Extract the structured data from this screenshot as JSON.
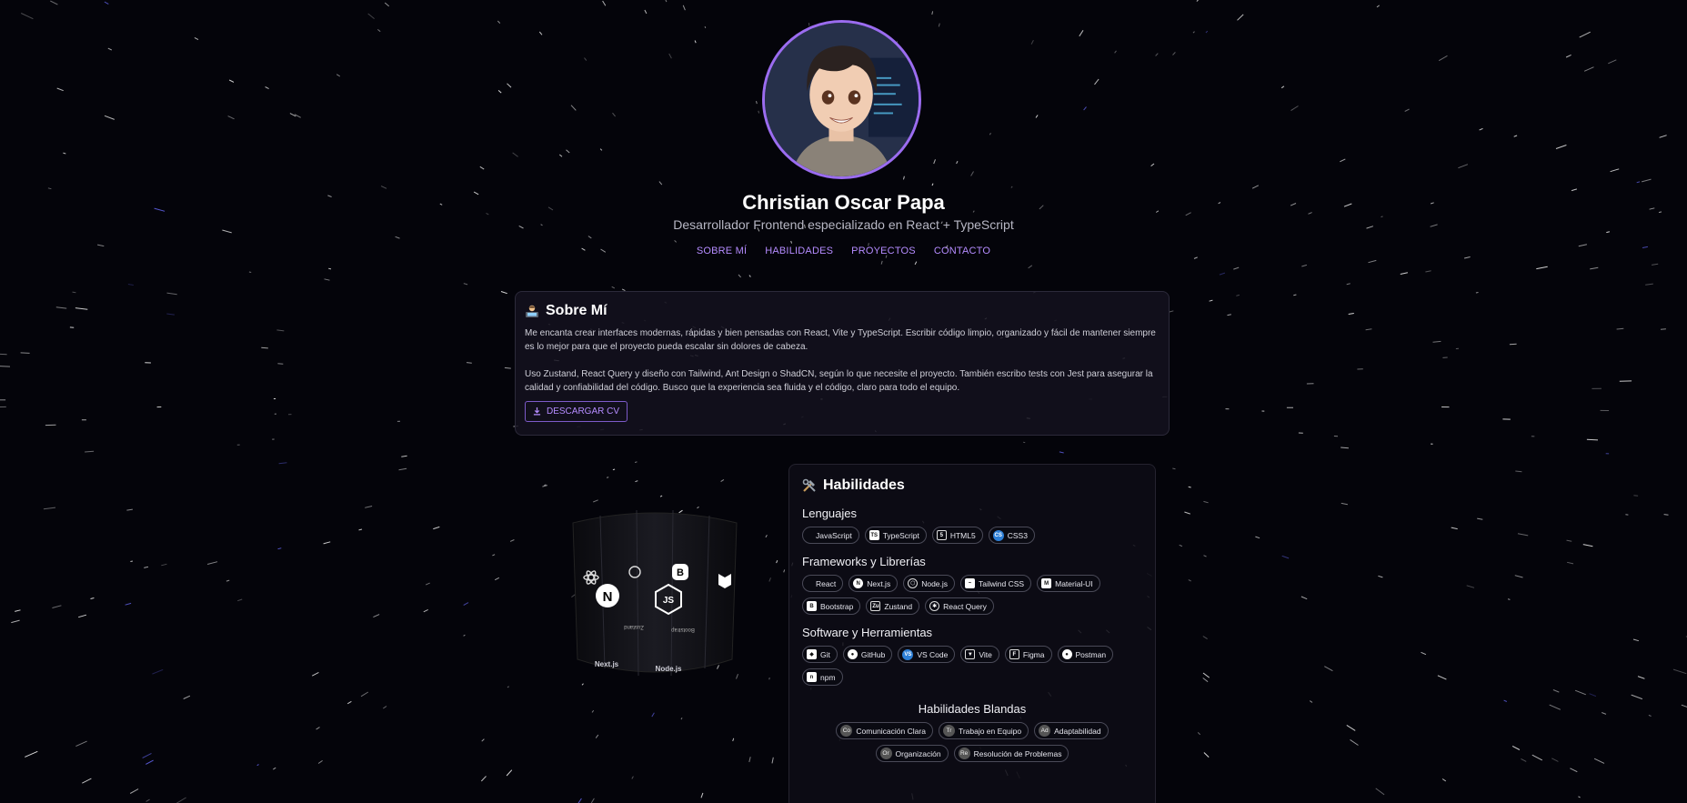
{
  "profile": {
    "name": "Christian Oscar Papa",
    "subtitle": "Desarrollador Frontend especializado en React + TypeScript"
  },
  "nav": [
    "SOBRE MÍ",
    "HABILIDADES",
    "PROYECTOS",
    "CONTACTO"
  ],
  "about": {
    "title": "Sobre Mí",
    "paragraph1": "Me encanta crear interfaces modernas, rápidas y bien pensadas con React, Vite y TypeScript. Escribir código limpio, organizado y fácil de mantener siempre es lo mejor para que el proyecto pueda escalar sin dolores de cabeza.",
    "paragraph2": "Uso Zustand, React Query y diseño con Tailwind, Ant Design o ShadCN, según lo que necesite el proyecto. También escribo tests con Jest para asegurar la calidad y confiabilidad del código. Busco que la experiencia sea fluida y el código, claro para todo el equipo.",
    "cv_button": "DESCARGAR CV"
  },
  "cylinder": {
    "labels": [
      "Next.js",
      "Node.js",
      "Zustand",
      "Bootstrap"
    ]
  },
  "skills": {
    "title": "Habilidades",
    "lenguajes": {
      "title": "Lenguajes",
      "items": [
        {
          "label": "JavaScript",
          "icon": "javascript-icon",
          "glyph": ""
        },
        {
          "label": "TypeScript",
          "icon": "typescript-icon",
          "glyph": "TS"
        },
        {
          "label": "HTML5",
          "icon": "html5-icon",
          "glyph": "5"
        },
        {
          "label": "CSS3",
          "icon": "css3-icon",
          "glyph": "CS"
        }
      ]
    },
    "frameworks": {
      "title": "Frameworks y Librerías",
      "items": [
        {
          "label": "React",
          "icon": "react-icon",
          "glyph": ""
        },
        {
          "label": "Next.js",
          "icon": "nextjs-icon",
          "glyph": "N"
        },
        {
          "label": "Node.js",
          "icon": "nodejs-icon",
          "glyph": "⬡"
        },
        {
          "label": "Tailwind CSS",
          "icon": "tailwind-icon",
          "glyph": "~"
        },
        {
          "label": "Material-UI",
          "icon": "material-ui-icon",
          "glyph": "M"
        },
        {
          "label": "Bootstrap",
          "icon": "bootstrap-icon",
          "glyph": "B"
        },
        {
          "label": "Zustand",
          "icon": "zustand-icon",
          "glyph": "Zu"
        },
        {
          "label": "React Query",
          "icon": "react-query-icon",
          "glyph": "✱"
        }
      ]
    },
    "software": {
      "title": "Software y Herramientas",
      "items": [
        {
          "label": "Git",
          "icon": "git-icon",
          "glyph": "◆"
        },
        {
          "label": "GitHub",
          "icon": "github-icon",
          "glyph": "●"
        },
        {
          "label": "VS Code",
          "icon": "vscode-icon",
          "glyph": "VS"
        },
        {
          "label": "Vite",
          "icon": "vite-icon",
          "glyph": "▼"
        },
        {
          "label": "Figma",
          "icon": "figma-icon",
          "glyph": "F"
        },
        {
          "label": "Postman",
          "icon": "postman-icon",
          "glyph": "●"
        },
        {
          "label": "npm",
          "icon": "npm-icon",
          "glyph": "n"
        }
      ]
    },
    "blandas": {
      "title": "Habilidades Blandas",
      "items": [
        {
          "label": "Comunicación Clara",
          "glyph": "Co"
        },
        {
          "label": "Trabajo en Equipo",
          "glyph": "Tr"
        },
        {
          "label": "Adaptabilidad",
          "glyph": "Ad"
        },
        {
          "label": "Organización",
          "glyph": "Or"
        },
        {
          "label": "Resolución de Problemas",
          "glyph": "Re"
        }
      ]
    }
  },
  "colors": {
    "background": "#04040a",
    "accent": "#b58cff",
    "card_border": "#2c2a3a"
  }
}
